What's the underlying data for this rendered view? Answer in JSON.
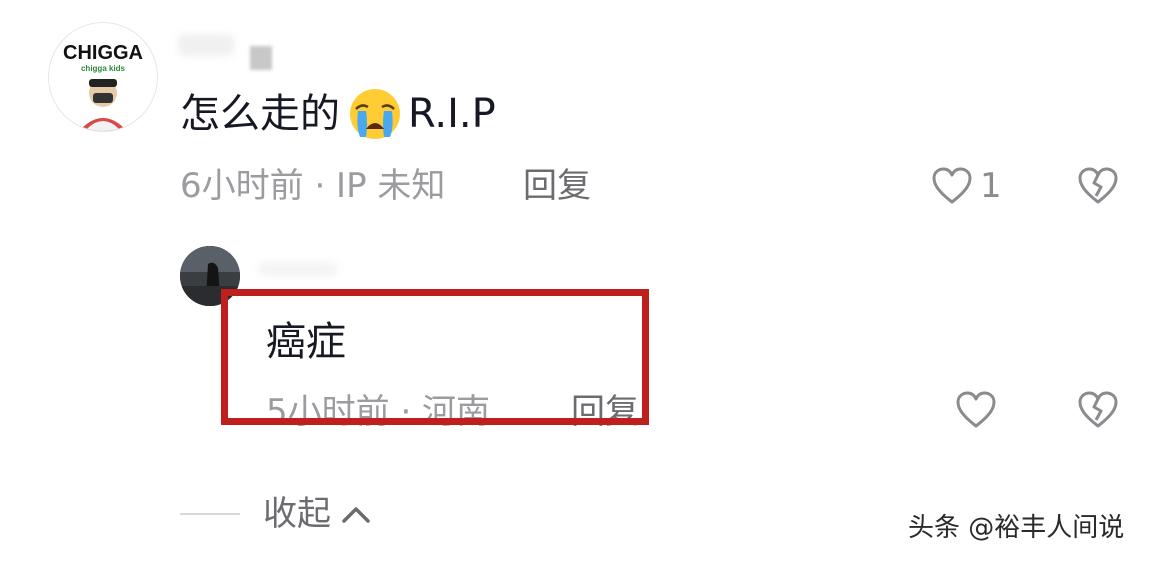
{
  "comment": {
    "avatar_logo_text": "CHIGGA",
    "avatar_logo_subtext": "chigga kids",
    "text": "怎么走的",
    "emoji": "loudly-crying-face",
    "text_suffix": "R.I.P",
    "time_location": "6小时前 · IP 未知",
    "reply_label": "回复",
    "like_count": "1"
  },
  "reply": {
    "text": "癌症",
    "time_location": "5小时前 · 河南",
    "reply_label": "回复"
  },
  "collapse_label": "收起",
  "watermark": "头条 @裕丰人间说",
  "colors": {
    "highlight": "#c0201d",
    "meta_text": "#9b9ba0",
    "icon": "#8a8a8f"
  }
}
